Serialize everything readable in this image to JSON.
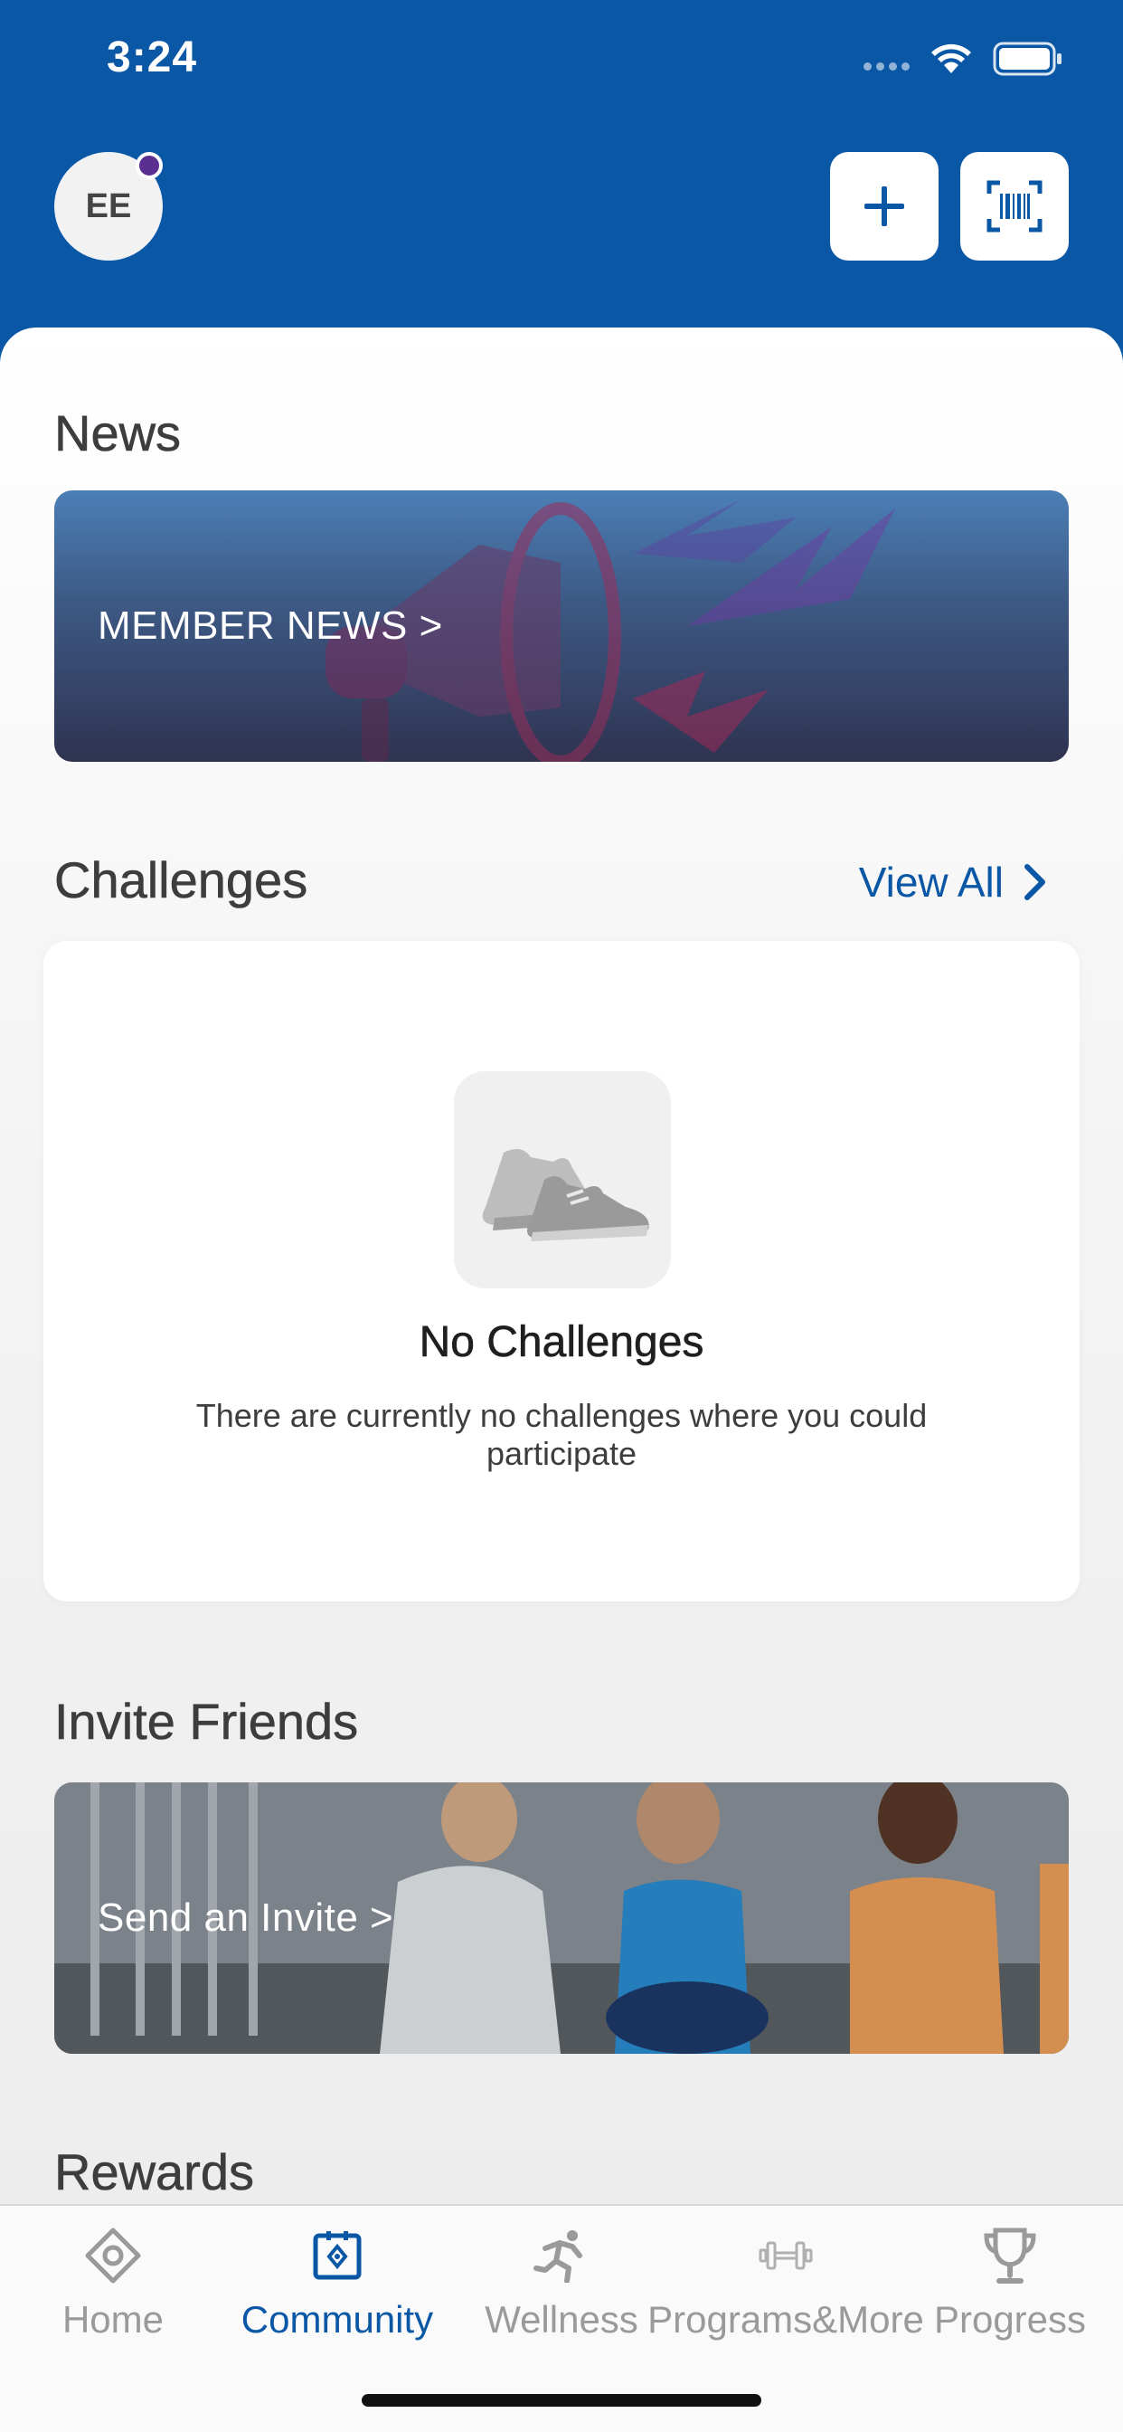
{
  "status_bar": {
    "time": "3:24"
  },
  "header": {
    "avatar_initials": "EE",
    "add_icon": "plus-icon",
    "scan_icon": "barcode-scan-icon",
    "accent_color": "#0a57a6",
    "notification_dot_color": "#5b2e91"
  },
  "news": {
    "title": "News",
    "banner_label": "MEMBER NEWS >"
  },
  "challenges": {
    "title": "Challenges",
    "view_all_label": "View All",
    "empty_icon": "sneakers-icon",
    "empty_title": "No Challenges",
    "empty_text": "There are currently no challenges where you could participate"
  },
  "invite": {
    "title": "Invite Friends",
    "banner_label": "Send an Invite >"
  },
  "rewards": {
    "title": "Rewards"
  },
  "tabbar": {
    "active_tab": "Community",
    "items": [
      {
        "label": "Home",
        "icon": "home-diamond-icon"
      },
      {
        "label": "Community",
        "icon": "community-icon"
      },
      {
        "label": "Wellness",
        "icon": "runner-icon"
      },
      {
        "label": "Programs&More",
        "icon": "dumbbell-icon"
      },
      {
        "label": "Progress",
        "icon": "trophy-icon"
      }
    ]
  }
}
